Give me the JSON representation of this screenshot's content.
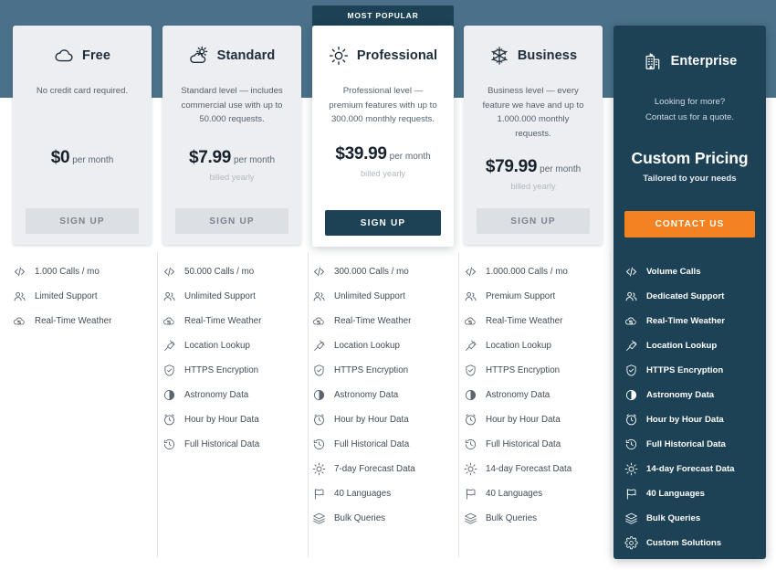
{
  "banner": {
    "label": "MOST POPULAR"
  },
  "colors": {
    "band": "#4a7189",
    "dark": "#1d4255",
    "accent": "#f58220",
    "card": "#eceef1",
    "card_featured": "#ffffff"
  },
  "plans": [
    {
      "id": "free",
      "icon": "cloud-icon",
      "name": "Free",
      "description": "No credit card required.",
      "price": "$0",
      "per": "per month",
      "billed": "",
      "cta": "SIGN UP",
      "cta_style": "ghost",
      "featured": false,
      "features": [
        {
          "icon": "code-icon",
          "label": "1.000 Calls / mo"
        },
        {
          "icon": "users-icon",
          "label": "Limited Support"
        },
        {
          "icon": "cloud-refresh-icon",
          "label": "Real-Time Weather"
        }
      ]
    },
    {
      "id": "standard",
      "icon": "cloud-sun-icon",
      "name": "Standard",
      "description": "Standard level — includes commercial use with up to 50.000 requests.",
      "price": "$7.99",
      "per": "per month",
      "billed": "billed yearly",
      "cta": "SIGN UP",
      "cta_style": "ghost",
      "featured": false,
      "features": [
        {
          "icon": "code-icon",
          "label": "50.000 Calls / mo"
        },
        {
          "icon": "users-icon",
          "label": "Unlimited Support"
        },
        {
          "icon": "cloud-refresh-icon",
          "label": "Real-Time Weather"
        },
        {
          "icon": "pin-icon",
          "label": "Location Lookup"
        },
        {
          "icon": "shield-icon",
          "label": "HTTPS Encryption"
        },
        {
          "icon": "moon-phase-icon",
          "label": "Astronomy Data"
        },
        {
          "icon": "clock-icon",
          "label": "Hour by Hour Data"
        },
        {
          "icon": "history-icon",
          "label": "Full Historical Data"
        }
      ]
    },
    {
      "id": "professional",
      "icon": "sun-icon",
      "name": "Professional",
      "description": "Professional level — premium features with up to 300.000 monthly requests.",
      "price": "$39.99",
      "per": "per month",
      "billed": "billed yearly",
      "cta": "SIGN UP",
      "cta_style": "primary",
      "featured": true,
      "features": [
        {
          "icon": "code-icon",
          "label": "300.000 Calls / mo"
        },
        {
          "icon": "users-icon",
          "label": "Unlimited Support"
        },
        {
          "icon": "cloud-refresh-icon",
          "label": "Real-Time Weather"
        },
        {
          "icon": "pin-icon",
          "label": "Location Lookup"
        },
        {
          "icon": "shield-icon",
          "label": "HTTPS Encryption"
        },
        {
          "icon": "moon-phase-icon",
          "label": "Astronomy Data"
        },
        {
          "icon": "clock-icon",
          "label": "Hour by Hour Data"
        },
        {
          "icon": "history-icon",
          "label": "Full Historical Data"
        },
        {
          "icon": "sun-icon",
          "label": "7-day Forecast Data"
        },
        {
          "icon": "flag-icon",
          "label": "40 Languages"
        },
        {
          "icon": "layers-icon",
          "label": "Bulk Queries"
        }
      ]
    },
    {
      "id": "business",
      "icon": "snowflake-icon",
      "name": "Business",
      "description": "Business level — every feature we have and up to 1.000.000 monthly requests.",
      "price": "$79.99",
      "per": "per month",
      "billed": "billed yearly",
      "cta": "SIGN UP",
      "cta_style": "ghost",
      "featured": false,
      "features": [
        {
          "icon": "code-icon",
          "label": "1.000.000 Calls / mo"
        },
        {
          "icon": "users-icon",
          "label": "Premium Support"
        },
        {
          "icon": "cloud-refresh-icon",
          "label": "Real-Time Weather"
        },
        {
          "icon": "pin-icon",
          "label": "Location Lookup"
        },
        {
          "icon": "shield-icon",
          "label": "HTTPS Encryption"
        },
        {
          "icon": "moon-phase-icon",
          "label": "Astronomy Data"
        },
        {
          "icon": "clock-icon",
          "label": "Hour by Hour Data"
        },
        {
          "icon": "history-icon",
          "label": "Full Historical Data"
        },
        {
          "icon": "sun-icon",
          "label": "14-day Forecast Data"
        },
        {
          "icon": "flag-icon",
          "label": "40 Languages"
        },
        {
          "icon": "layers-icon",
          "label": "Bulk Queries"
        }
      ]
    },
    {
      "id": "enterprise",
      "icon": "building-icon",
      "name": "Enterprise",
      "description": "Looking for more?\nContact us for a quote.",
      "price": "Custom Pricing",
      "per": "",
      "billed": "Tailored to your needs",
      "cta": "CONTACT US",
      "cta_style": "accent",
      "featured": false,
      "features": [
        {
          "icon": "code-icon",
          "label": "Volume Calls"
        },
        {
          "icon": "users-icon",
          "label": "Dedicated Support"
        },
        {
          "icon": "cloud-refresh-icon",
          "label": "Real-Time Weather"
        },
        {
          "icon": "pin-icon",
          "label": "Location Lookup"
        },
        {
          "icon": "shield-icon",
          "label": "HTTPS Encryption"
        },
        {
          "icon": "moon-phase-icon",
          "label": "Astronomy Data"
        },
        {
          "icon": "clock-icon",
          "label": "Hour by Hour Data"
        },
        {
          "icon": "history-icon",
          "label": "Full Historical Data"
        },
        {
          "icon": "sun-icon",
          "label": "14-day Forecast Data"
        },
        {
          "icon": "flag-icon",
          "label": "40 Languages"
        },
        {
          "icon": "layers-icon",
          "label": "Bulk Queries"
        },
        {
          "icon": "gear-icon",
          "label": "Custom Solutions"
        }
      ]
    }
  ]
}
